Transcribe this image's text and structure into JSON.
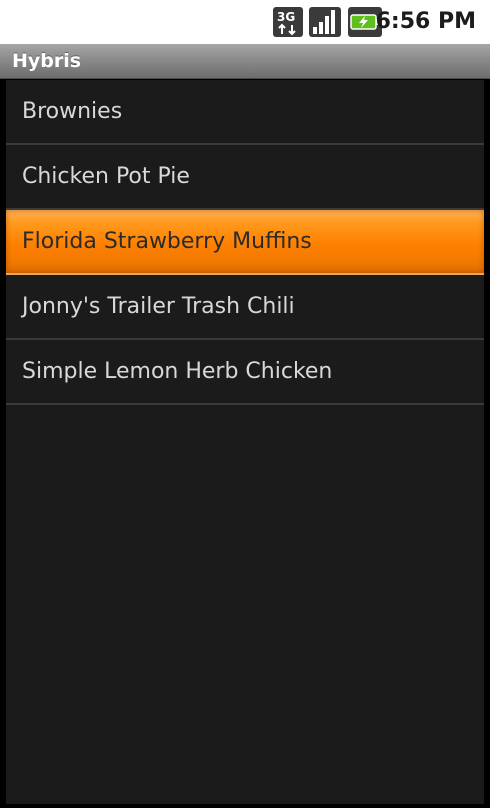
{
  "status_bar": {
    "network_label": "3G",
    "time": "6:56 PM",
    "icons": [
      "3g-data-icon",
      "signal-strength-icon",
      "battery-charging-icon"
    ]
  },
  "title_bar": {
    "title": "Hybris"
  },
  "recipes": {
    "items": [
      {
        "label": "Brownies",
        "selected": false
      },
      {
        "label": "Chicken Pot Pie",
        "selected": false
      },
      {
        "label": "Florida Strawberry Muffins",
        "selected": true
      },
      {
        "label": "Jonny's Trailer Trash Chili",
        "selected": false
      },
      {
        "label": "Simple Lemon Herb Chicken",
        "selected": false
      }
    ]
  },
  "colors": {
    "selection_accent": "#ff8000",
    "list_background": "#1b1b1b",
    "divider": "#3a3a3a",
    "title_bar": "#8b8b8b"
  }
}
